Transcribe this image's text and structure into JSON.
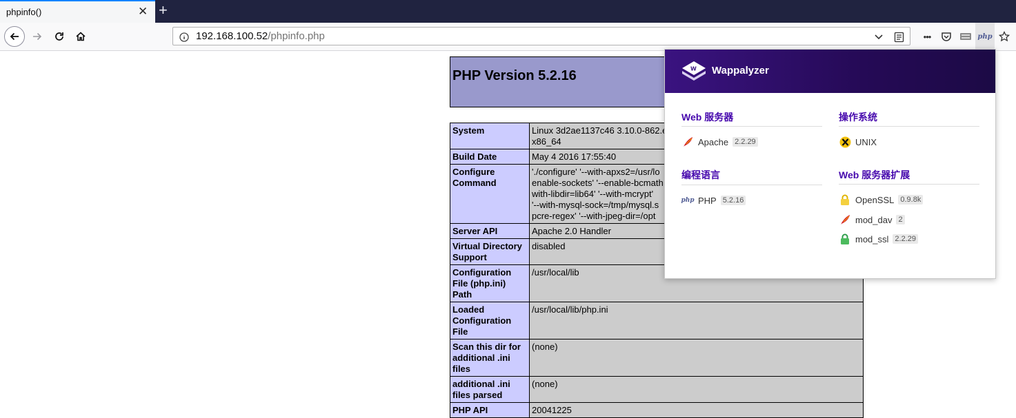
{
  "browser": {
    "tab_title": "phpinfo()",
    "tab_close": "✕",
    "new_tab": "+",
    "url_host": "192.168.100.52",
    "url_path": "/phpinfo.php",
    "more_label": "•••"
  },
  "php": {
    "version_title": "PHP Version 5.2.16",
    "rows": [
      {
        "key": "System",
        "value": "Linux 3d2ae1137c46 3.10.0-862.el\nx86_64"
      },
      {
        "key": "Build Date",
        "value": "May 4 2016 17:55:40"
      },
      {
        "key": "Configure Command",
        "value": "'./configure' '--with-apxs2=/usr/lo\nenable-sockets' '--enable-bcmath\nwith-libdir=lib64' '--with-mcrypt'\n'--with-mysql-sock=/tmp/mysql.s\npcre-regex' '--with-jpeg-dir=/opt"
      },
      {
        "key": "Server API",
        "value": "Apache 2.0 Handler"
      },
      {
        "key": "Virtual Directory Support",
        "value": "disabled"
      },
      {
        "key": "Configuration File (php.ini) Path",
        "value": "/usr/local/lib"
      },
      {
        "key": "Loaded Configuration File",
        "value": "/usr/local/lib/php.ini"
      },
      {
        "key": "Scan this dir for additional .ini files",
        "value": "(none)"
      },
      {
        "key": "additional .ini files parsed",
        "value": "(none)"
      },
      {
        "key": "PHP API",
        "value": "20041225"
      }
    ]
  },
  "wappalyzer": {
    "title": "Wappalyzer",
    "categories": [
      {
        "name": "Web 服务器",
        "techs": [
          {
            "name": "Apache",
            "version": "2.2.29",
            "icon": "feather-icon"
          }
        ]
      },
      {
        "name": "编程语言",
        "techs": [
          {
            "name": "PHP",
            "version": "5.2.16",
            "icon": "php-icon"
          }
        ]
      },
      {
        "name": "操作系统",
        "techs": [
          {
            "name": "UNIX",
            "version": "",
            "icon": "x-unix-icon"
          }
        ]
      },
      {
        "name": "Web 服务器扩展",
        "techs": [
          {
            "name": "OpenSSL",
            "version": "0.9.8k",
            "icon": "lock-icon"
          },
          {
            "name": "mod_dav",
            "version": "2",
            "icon": "feather-icon"
          },
          {
            "name": "mod_ssl",
            "version": "2.2.29",
            "icon": "lock-green-icon"
          }
        ]
      }
    ]
  },
  "colors": {
    "tabstrip": "#202340",
    "php_header": "#9999cc",
    "php_key": "#ccccff",
    "php_value": "#cccccc",
    "wap_purple": "#4608ad",
    "wap_header": "#2a0d63"
  }
}
